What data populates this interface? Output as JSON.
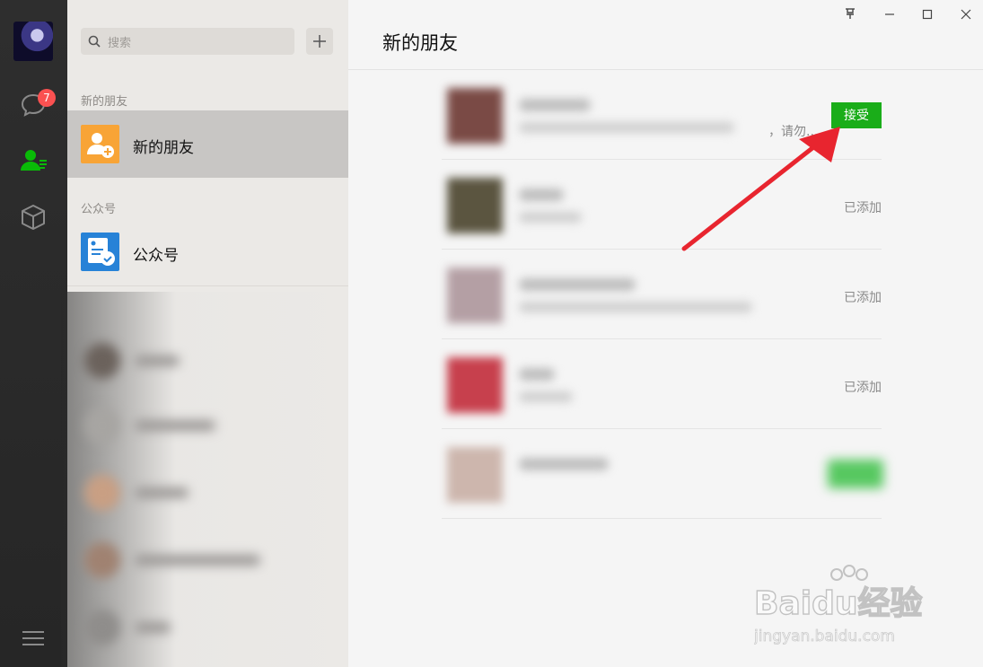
{
  "sidebar": {
    "unread_badge": "7",
    "icons": [
      "avatar",
      "chat-icon",
      "contacts-icon",
      "box-icon",
      "menu-icon"
    ]
  },
  "contacts": {
    "search_placeholder": "搜索",
    "add_button": "+",
    "section_new_friends": "新的朋友",
    "item_new_friends": "新的朋友",
    "section_official": "公众号",
    "item_official": "公众号"
  },
  "main": {
    "title": "新的朋友",
    "window_controls": [
      "pin",
      "minimize",
      "maximize",
      "close"
    ],
    "requests": [
      {
        "status": "接受",
        "message_tail": "，请勿..."
      },
      {
        "status": "已添加"
      },
      {
        "status": "已添加"
      },
      {
        "status": "已添加"
      },
      {
        "status": ""
      }
    ]
  },
  "watermark": {
    "line1": "Baidu经验",
    "line2": "jingyan.baidu.com"
  },
  "colors": {
    "accent_green": "#1aad19",
    "badge_red": "#fa5151",
    "annotation_red": "#e8252f"
  }
}
